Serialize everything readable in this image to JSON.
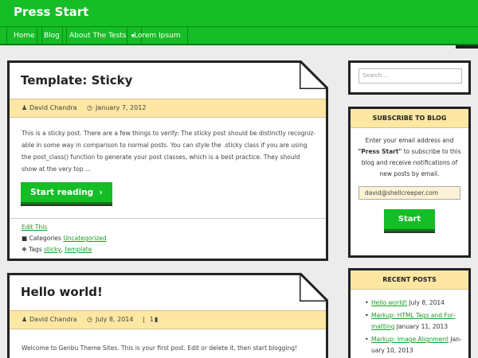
{
  "site": {
    "title": "Press Start"
  },
  "nav": {
    "items": [
      {
        "label": "Home"
      },
      {
        "label": "Blog"
      },
      {
        "label": "About The Tests",
        "caret": "▼"
      },
      {
        "label": "Lorem Ipsum"
      }
    ]
  },
  "posts": [
    {
      "title": "Template: Sticky",
      "author": "David Chandra",
      "date": "January 7, 2012",
      "excerpt": "This is a sticky post. There are a few things to verify: The sticky post should be distinctly recogniz-able in some way in comparison to normal posts. You can style the .sticky class if you are using the post_class() function to generate your post classes, which is a best practice. They should show at the very top ...",
      "read_more": "Start reading",
      "edit": "Edit This",
      "categories_label": "Categories",
      "category": "Uncategorized",
      "tags_label": "Tags",
      "tags": [
        "sticky",
        "template"
      ],
      "tags_sep": ","
    },
    {
      "title": "Hello world!",
      "author": "David Chandra",
      "date": "July 8, 2014",
      "comments": "1",
      "excerpt": "Welcome to Genbu Theme Sites. This is your first post. Edit or delete it, then start blogging!"
    }
  ],
  "sidebar": {
    "search": {
      "placeholder": "Search ..."
    },
    "subscribe": {
      "heading": "SUBSCRIBE TO BLOG",
      "text_before": "Enter your email address and",
      "site_name": "\"Press Start\"",
      "text_after": "to subscribe to this blog and receive notifications of new posts by email.",
      "email": "david@shellcreeper.com",
      "button": "Start"
    },
    "recent": {
      "heading": "RECENT POSTS",
      "items": [
        {
          "title": "Hello world!",
          "date": "July 8, 2014"
        },
        {
          "title": "Markup: HTML Tags and For-matting",
          "date": "January 11, 2013"
        },
        {
          "title": "Markup: Image Alignment",
          "date": "Jan-uary 10, 2013"
        }
      ]
    }
  },
  "colors": {
    "accent": "#15bd26",
    "meta_bg": "#fde7a3",
    "border": "#222222"
  }
}
